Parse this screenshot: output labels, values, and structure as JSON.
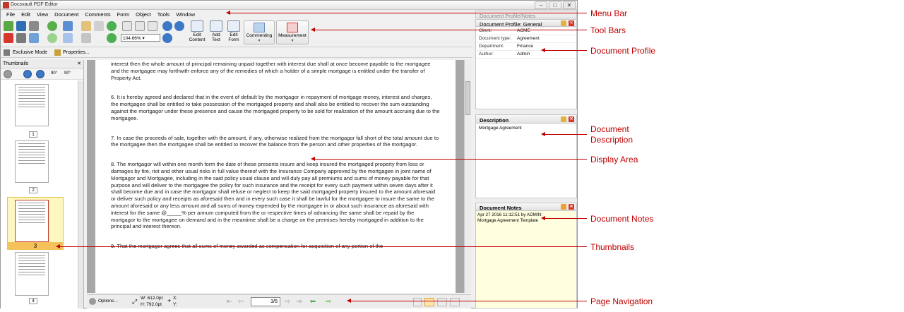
{
  "window": {
    "title": "Docsvault PDF Editor"
  },
  "menu": [
    "File",
    "Edit",
    "View",
    "Document",
    "Comments",
    "Form",
    "Object",
    "Tools",
    "Window"
  ],
  "toolbar": {
    "zoom_value": "104.66%",
    "edit_content": "Edit Content",
    "add_text": "Add Text",
    "edit_form": "Edit Form",
    "commenting": "Commenting",
    "measurement": "Measurement"
  },
  "subbar": {
    "exclusive_mode": "Exclusive Mode",
    "properties": "Properties..."
  },
  "thumbnails": {
    "title": "Thumbnails",
    "rotate_left": "90°",
    "rotate_right": "90°",
    "pages": [
      "1",
      "2",
      "3",
      "4"
    ],
    "selected": "3"
  },
  "document": {
    "paragraphs": [
      "interest then the whole amount of principal remaining unpaid together with interest due shall at once become payable to the mortgagee and the mortgagee may forthwith enforce any of the remedies of which a holder of a simple mortgage is entitled under the transfer of Property Act.",
      "6. It is hereby agreed and declared that in the event of default by the mortgagor in repayment of mortgage money, interest and charges, the mortgagee shall be entitled to take possession of the mortgaged property and shall also be entitled to recover the sum outstanding against the mortgagor under these presence and cause the mortgaged property to be sold for realization of the amount accruing due to the mortgagee.",
      "7. In case the proceeds of sale, together with the amount, if any, otherwise realized from the mortgagor fall short of the total amount due to the mortgagee then the mortgagee shall be entitled to recover the balance from the person and other properties of the mortgagor.",
      "8. The mortgagor will within one month form the date of these presents insure and keep insured the mortgaged property from loss or damages by fire, riot and other usual risks in full value thereof with the Insurance Company approved by the mortgagee in joint name of Mortgagor and Mortgagee, including in the said policy usual clause and will duly pay all premiums and sums of money payable for that purpose and will deliver to the mortgagee the policy for such insurance and the receipt for every such payment within seven days after it shall become due and in case the mortgagor shall refuse or neglect to keep the said mortgaged property insured to the amount aforesaid or deliver such policy and receipts as aforesaid then and in every such case it shall be lawful for the mortgagee to insure the same to the amount aforesaid or any less amount and all sums of money expended by the mortgagee in or about such insurance as aforesaid with interest for the same @_____% per annum computed from the or respective times of advancing the same shall be repaid by the mortgagor to the mortgagee on demand and in the meantime shall be a charge on the premises hereby mortgaged in addition to the principal and interest thereon.",
      "9. That the mortgagor agrees that all sums of money awarded as compensation for acquisition of any portion of the"
    ]
  },
  "navigation": {
    "options": "Options...",
    "width": "W: 612.0pt",
    "height": "H: 792.0pt",
    "x_label": "X:",
    "y_label": "Y:",
    "page_indicator": "3/5"
  },
  "profile_panel": {
    "title": "Document Profile/Notes",
    "subtitle": "Document Profile: General",
    "rows": [
      {
        "key": "Client:",
        "value": "ACME"
      },
      {
        "key": "Document type:",
        "value": "Agreement"
      },
      {
        "key": "Department:",
        "value": "Finance"
      },
      {
        "key": "Author:",
        "value": "Admin"
      }
    ]
  },
  "description_panel": {
    "title": "Description",
    "text": "Mortgage Agreement"
  },
  "notes_panel": {
    "title": "Document Notes",
    "note_header": "Apr 27 2016 11:12:51 by  ADMIN:",
    "note_text": "Mortgage Agreement Template"
  },
  "annotations": [
    "Menu Bar",
    "Tool Bars",
    "Document Profile",
    "Document Description",
    "Display Area",
    "Document Notes",
    "Thumbnails",
    "Page Navigation"
  ],
  "colors": {
    "annotation": "#c00000",
    "notes_bg": "#ffffe0",
    "thumb_selected": "#f5c15a"
  }
}
